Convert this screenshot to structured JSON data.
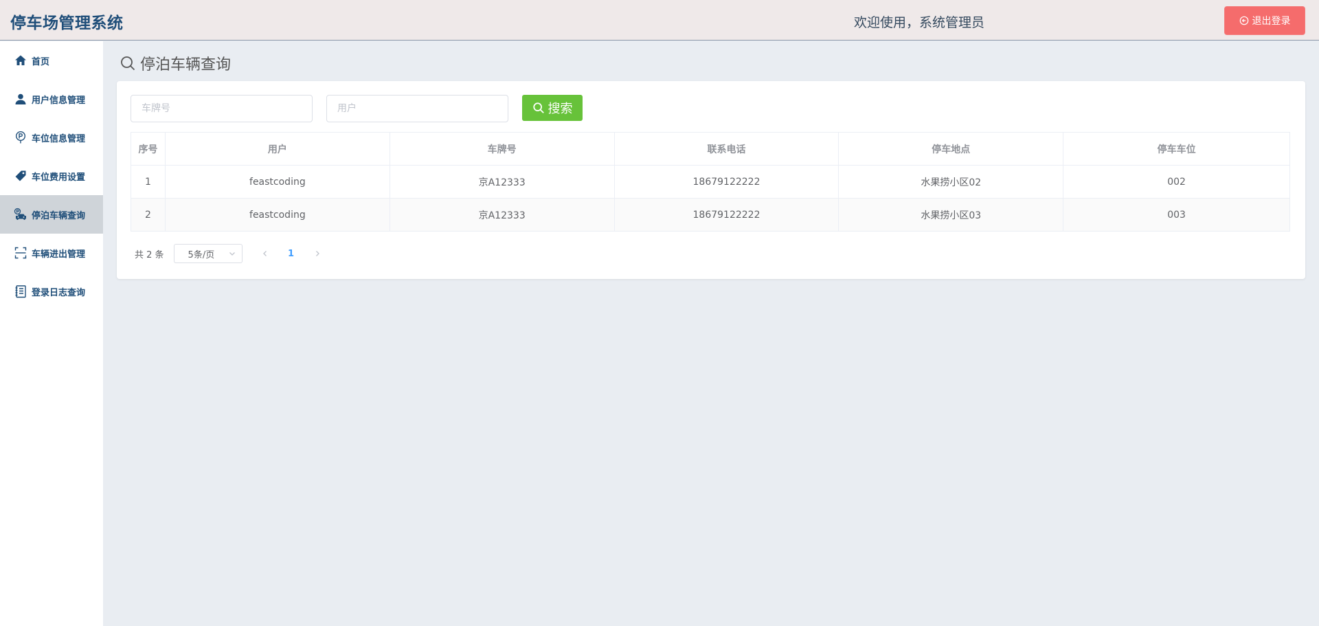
{
  "header": {
    "app_title": "停车场管理系统",
    "welcome": "欢迎使用，系统管理员",
    "logout_label": "退出登录"
  },
  "sidebar": {
    "items": [
      {
        "label": "首页",
        "icon": "home-icon"
      },
      {
        "label": "用户信息管理",
        "icon": "user-icon"
      },
      {
        "label": "车位信息管理",
        "icon": "parking-icon"
      },
      {
        "label": "车位费用设置",
        "icon": "price-tag-icon"
      },
      {
        "label": "停泊车辆查询",
        "icon": "parked-car-icon",
        "active": true
      },
      {
        "label": "车辆进出管理",
        "icon": "scan-icon"
      },
      {
        "label": "登录日志查询",
        "icon": "notebook-icon"
      }
    ]
  },
  "page": {
    "title": "停泊车辆查询"
  },
  "search": {
    "plate_placeholder": "车牌号",
    "user_placeholder": "用户",
    "button_label": "搜索"
  },
  "table": {
    "headers": [
      "序号",
      "用户",
      "车牌号",
      "联系电话",
      "停车地点",
      "停车车位"
    ],
    "rows": [
      [
        "1",
        "feastcoding",
        "京A12333",
        "18679122222",
        "水果捞小区02",
        "002"
      ],
      [
        "2",
        "feastcoding",
        "京A12333",
        "18679122222",
        "水果捞小区03",
        "003"
      ]
    ]
  },
  "pagination": {
    "total": "共 2 条",
    "page_size": "5条/页",
    "current_page": "1"
  },
  "colors": {
    "brand": "#1f4e79",
    "logout": "#f56c6c",
    "search": "#67c23a",
    "active_page": "#409eff"
  }
}
